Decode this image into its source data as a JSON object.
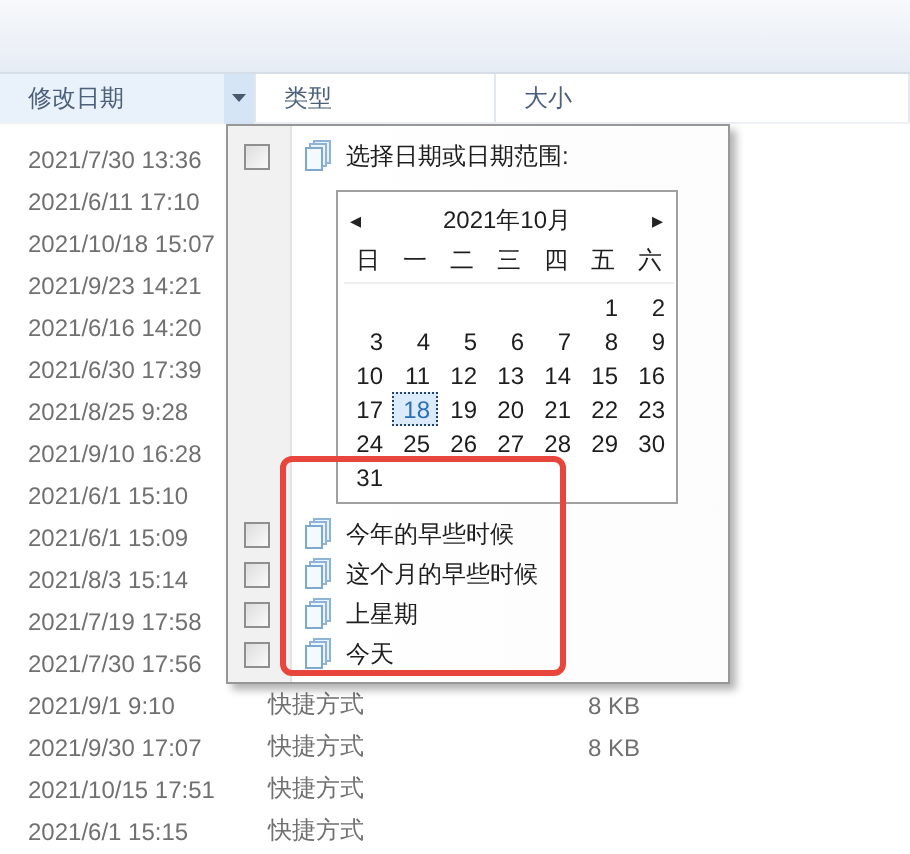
{
  "columns": [
    {
      "label": "修改日期",
      "sorted": true
    },
    {
      "label": "类型",
      "sorted": false
    },
    {
      "label": "大小",
      "sorted": false
    }
  ],
  "rows": [
    {
      "date": "2021/7/30 13:36"
    },
    {
      "date": "2021/6/11 17:10"
    },
    {
      "date": "2021/10/18 15:07"
    },
    {
      "date": "2021/9/23 14:21"
    },
    {
      "date": "2021/6/16 14:20"
    },
    {
      "date": "2021/6/30 17:39"
    },
    {
      "date": "2021/8/25 9:28"
    },
    {
      "date": "2021/9/10 16:28"
    },
    {
      "date": "2021/6/1 15:10"
    },
    {
      "date": "2021/6/1 15:09"
    },
    {
      "date": "2021/8/3 15:14"
    },
    {
      "date": "2021/7/19 17:58"
    },
    {
      "date": "2021/7/30 17:56"
    },
    {
      "date": "2021/9/1 9:10",
      "type": "快捷方式",
      "size": "8 KB"
    },
    {
      "date": "2021/9/30 17:07",
      "type": "快捷方式",
      "size": "8 KB"
    },
    {
      "date": "2021/10/15 17:51",
      "type": "快捷方式"
    },
    {
      "date": "2021/6/1 15:15",
      "type": "快捷方式"
    }
  ],
  "date_filter": {
    "range_option": {
      "label": "选择日期或日期范围:",
      "checked": false
    },
    "calendar": {
      "prev": "◂",
      "title": "2021年10月",
      "next": "▸",
      "weekdays": [
        "日",
        "一",
        "二",
        "三",
        "四",
        "五",
        "六"
      ],
      "weeks": [
        {
          "right_aligned": true,
          "days": [
            {
              "day": "1",
              "selected": false
            },
            {
              "day": "2",
              "selected": false
            }
          ]
        },
        {
          "days": [
            {
              "day": "3",
              "selected": false
            },
            {
              "day": "4",
              "selected": false
            },
            {
              "day": "5",
              "selected": false
            },
            {
              "day": "6",
              "selected": false
            },
            {
              "day": "7",
              "selected": false
            },
            {
              "day": "8",
              "selected": false
            },
            {
              "day": "9",
              "selected": false
            }
          ]
        },
        {
          "days": [
            {
              "day": "10",
              "selected": false
            },
            {
              "day": "11",
              "selected": false
            },
            {
              "day": "12",
              "selected": false
            },
            {
              "day": "13",
              "selected": false
            },
            {
              "day": "14",
              "selected": false
            },
            {
              "day": "15",
              "selected": false
            },
            {
              "day": "16",
              "selected": false
            }
          ]
        },
        {
          "days": [
            {
              "day": "17",
              "selected": false
            },
            {
              "day": "18",
              "selected": true
            },
            {
              "day": "19",
              "selected": false
            },
            {
              "day": "20",
              "selected": false
            },
            {
              "day": "21",
              "selected": false
            },
            {
              "day": "22",
              "selected": false
            },
            {
              "day": "23",
              "selected": false
            }
          ]
        },
        {
          "days": [
            {
              "day": "24",
              "selected": false
            },
            {
              "day": "25",
              "selected": false
            },
            {
              "day": "26",
              "selected": false
            },
            {
              "day": "27",
              "selected": false
            },
            {
              "day": "28",
              "selected": false
            },
            {
              "day": "29",
              "selected": false
            },
            {
              "day": "30",
              "selected": false
            }
          ]
        },
        {
          "right_aligned": false,
          "days": [
            {
              "day": "31",
              "selected": false
            }
          ]
        }
      ]
    },
    "options": [
      {
        "label": "今年的早些时候",
        "checked": false
      },
      {
        "label": "这个月的早些时候",
        "checked": false
      },
      {
        "label": "上星期",
        "checked": false
      },
      {
        "label": "今天",
        "checked": false
      }
    ]
  },
  "highlight": {
    "shown": true
  }
}
